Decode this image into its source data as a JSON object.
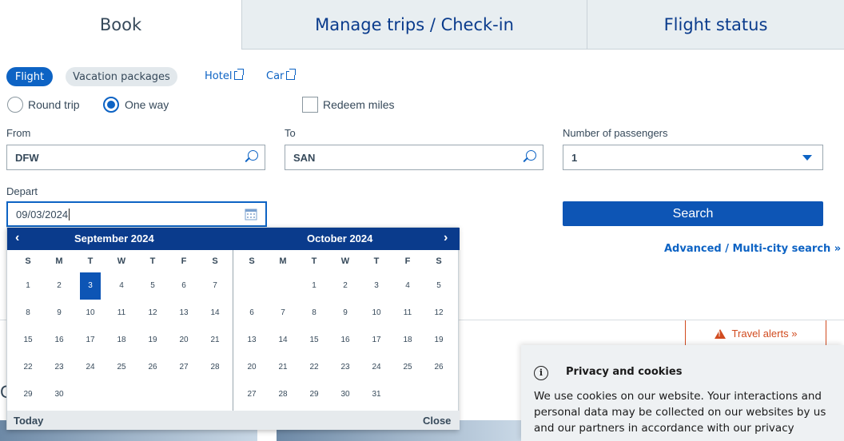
{
  "tabs": [
    {
      "label": "Book"
    },
    {
      "label": "Manage trips / Check-in"
    },
    {
      "label": "Flight status"
    }
  ],
  "product_tabs": {
    "flight": "Flight",
    "vacation": "Vacation packages",
    "hotel": "Hotel",
    "car": "Car"
  },
  "trip_type": {
    "round_trip": "Round trip",
    "one_way": "One way",
    "selected": "One way"
  },
  "redeem_miles": "Redeem miles",
  "from": {
    "label": "From",
    "value": "DFW"
  },
  "to": {
    "label": "To",
    "value": "SAN"
  },
  "passengers": {
    "label": "Number of passengers",
    "value": "1"
  },
  "depart": {
    "label": "Depart",
    "value": "09/03/2024"
  },
  "search_button": "Search",
  "advanced_link": "Advanced / Multi-city search »",
  "calendar": {
    "prev_icon": "‹",
    "next_icon": "›",
    "months": [
      {
        "title": "September 2024",
        "days_of_week": [
          "S",
          "M",
          "T",
          "W",
          "T",
          "F",
          "S"
        ],
        "weeks": [
          [
            "1",
            "2",
            "3",
            "4",
            "5",
            "6",
            "7"
          ],
          [
            "8",
            "9",
            "10",
            "11",
            "12",
            "13",
            "14"
          ],
          [
            "15",
            "16",
            "17",
            "18",
            "19",
            "20",
            "21"
          ],
          [
            "22",
            "23",
            "24",
            "25",
            "26",
            "27",
            "28"
          ],
          [
            "29",
            "30",
            "",
            "",
            "",
            "",
            ""
          ]
        ],
        "selected": "3"
      },
      {
        "title": "October 2024",
        "days_of_week": [
          "S",
          "M",
          "T",
          "W",
          "T",
          "F",
          "S"
        ],
        "weeks": [
          [
            "",
            "",
            "1",
            "2",
            "3",
            "4",
            "5"
          ],
          [
            "6",
            "7",
            "8",
            "9",
            "10",
            "11",
            "12"
          ],
          [
            "13",
            "14",
            "15",
            "16",
            "17",
            "18",
            "19"
          ],
          [
            "20",
            "21",
            "22",
            "23",
            "24",
            "25",
            "26"
          ],
          [
            "27",
            "28",
            "29",
            "30",
            "31",
            "",
            ""
          ]
        ]
      }
    ],
    "today": "Today",
    "close": "Close"
  },
  "travel_alerts": "Travel alerts »",
  "fragment_letter": "C",
  "privacy": {
    "title": "Privacy and cookies",
    "body": "We use cookies on our website. Your interactions and personal data may be collected on our websites by us and our partners in accordance with our privacy"
  },
  "colors": {
    "brand_blue": "#0d63c4",
    "navy": "#0a3b8c",
    "alert_orange": "#d14b1f"
  }
}
